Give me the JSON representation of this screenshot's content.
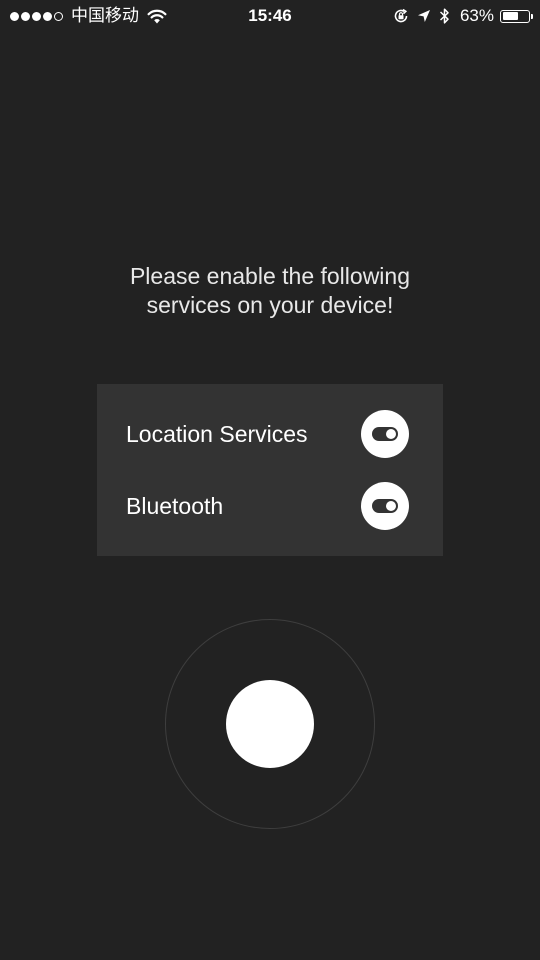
{
  "status_bar": {
    "signal_dots": [
      true,
      true,
      true,
      true,
      false
    ],
    "carrier": "中国移动",
    "time": "15:46",
    "battery_percent_text": "63%",
    "battery_level": 0.63,
    "icons": [
      "wifi-icon",
      "orientation-lock-icon",
      "location-arrow-icon",
      "bluetooth-icon",
      "battery-icon"
    ]
  },
  "prompt": {
    "line1": "Please enable the following",
    "line2": "services on your device!"
  },
  "services": [
    {
      "label": "Location Services",
      "icon": "toggle-icon"
    },
    {
      "label": "Bluetooth",
      "icon": "toggle-icon"
    }
  ],
  "colors": {
    "background": "#222222",
    "panel": "#333333",
    "ring": "#3e3e3e",
    "foreground": "#ffffff"
  }
}
